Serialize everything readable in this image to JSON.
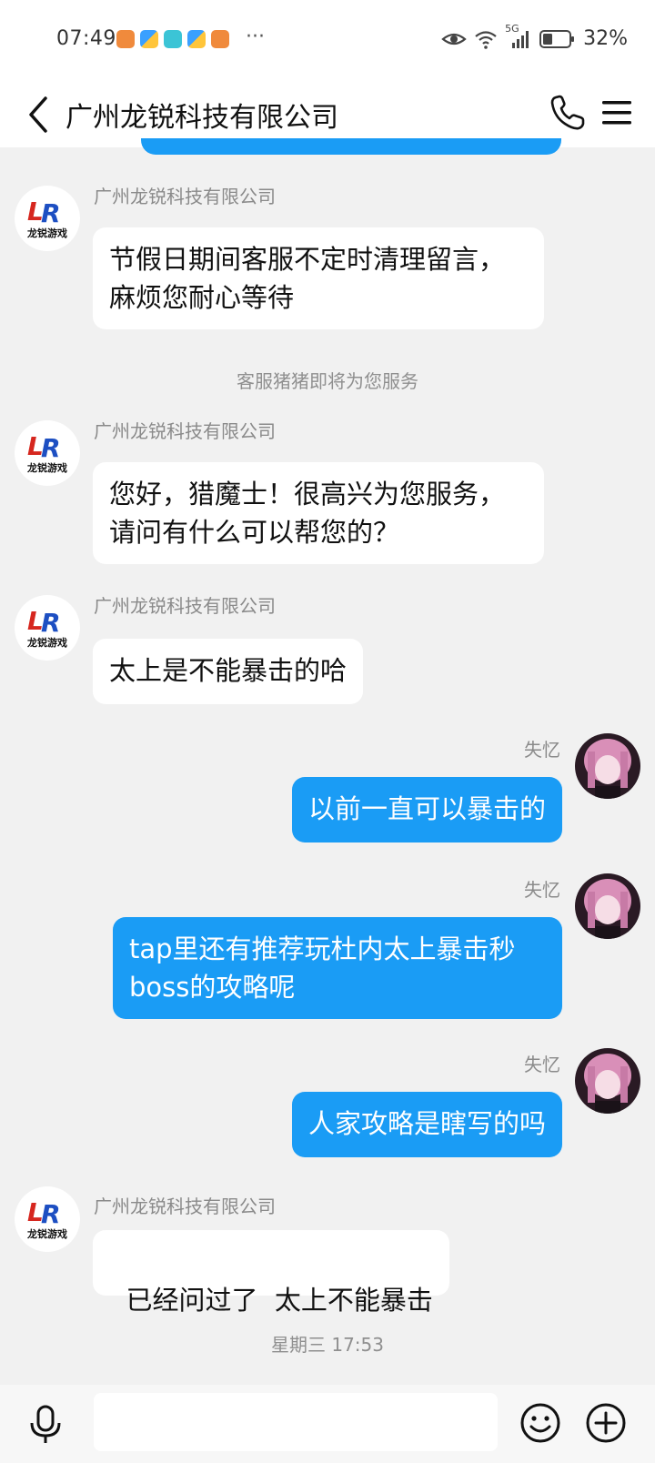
{
  "status_bar": {
    "time": "07:49",
    "more": "···",
    "network": "5G",
    "battery": "32%"
  },
  "header": {
    "title": "广州龙锐科技有限公司"
  },
  "messages": [
    {
      "sender": "广州龙锐科技有限公司",
      "text_lines": [
        "节假日期间客服不定时清理留言，",
        "麻烦您耐心等待"
      ]
    },
    {
      "system": "客服猪猪即将为您服务"
    },
    {
      "sender": "广州龙锐科技有限公司",
      "text_lines": [
        "您好，猎魔士！很高兴为您服务，",
        "请问有什么可以帮您的？"
      ]
    },
    {
      "sender": "广州龙锐科技有限公司",
      "text": "太上是不能暴击的哈"
    },
    {
      "sender": "失忆",
      "text": "以前一直可以暴击的"
    },
    {
      "sender": "失忆",
      "text_lines": [
        "tap里还有推荐玩杜内太上暴击秒",
        "boss的攻略呢"
      ]
    },
    {
      "sender": "失忆",
      "text": "人家攻略是瞎写的吗"
    },
    {
      "sender": "广州龙锐科技有限公司",
      "text": "已经问过了  太上不能暴击"
    },
    {
      "system": "星期三 17:53"
    }
  ],
  "company_logo": {
    "mark": "LR",
    "caption": "龙锐游戏"
  },
  "input": {
    "placeholder": ""
  },
  "colors": {
    "outgoing_bubble": "#1a9cf5",
    "incoming_bubble": "#ffffff",
    "background": "#f1f1f1"
  }
}
